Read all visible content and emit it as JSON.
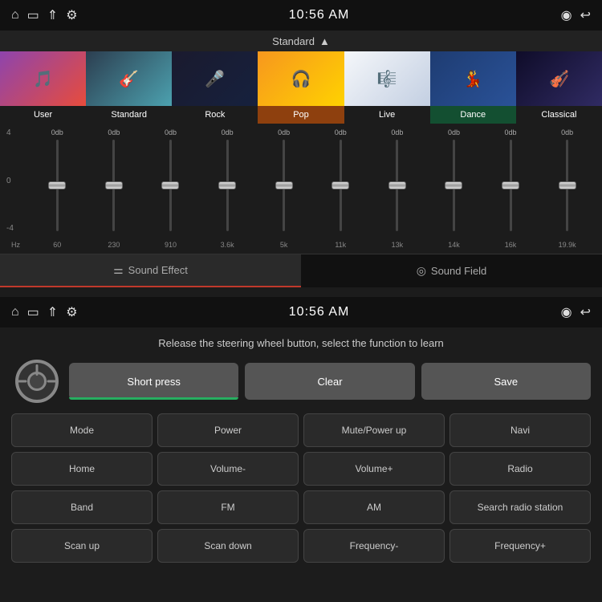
{
  "top": {
    "status_bar": {
      "time": "10:56 AM",
      "icons_left": [
        "home",
        "screen",
        "up-arrow",
        "usb"
      ],
      "icons_right": [
        "location",
        "back"
      ]
    },
    "genre_selector": {
      "label": "Standard",
      "arrow": "▲"
    },
    "genres": [
      {
        "name": "User",
        "active": false
      },
      {
        "name": "Standard",
        "active": false
      },
      {
        "name": "Rock",
        "active": false
      },
      {
        "name": "Pop",
        "active": true
      },
      {
        "name": "Live",
        "active": false
      },
      {
        "name": "Dance",
        "active": false
      },
      {
        "name": "Classical",
        "active": false
      }
    ],
    "eq": {
      "db_labels": [
        "0db",
        "0db",
        "0db",
        "0db",
        "0db",
        "0db",
        "0db",
        "0db",
        "0db",
        "0db"
      ],
      "freq_labels": [
        "60",
        "230",
        "910",
        "3.6k",
        "5k",
        "11k",
        "13k",
        "14k",
        "16k",
        "19.9k"
      ],
      "y_labels": [
        "4",
        "0",
        "-4"
      ],
      "hz_label": "Hz"
    },
    "tabs": [
      {
        "label": "Sound Effect",
        "icon": "sliders",
        "active": true
      },
      {
        "label": "Sound Field",
        "icon": "circle-dot",
        "active": false
      }
    ]
  },
  "bottom": {
    "status_bar": {
      "time": "10:56 AM"
    },
    "instruction": "Release the steering wheel button, select the function to learn",
    "controls": {
      "short_press_label": "Short press",
      "clear_label": "Clear",
      "save_label": "Save"
    },
    "functions": [
      "Mode",
      "Power",
      "Mute/Power up",
      "Navi",
      "Home",
      "Volume-",
      "Volume+",
      "Radio",
      "Band",
      "FM",
      "AM",
      "Search radio station",
      "Scan up",
      "Scan down",
      "Frequency-",
      "Frequency+"
    ]
  }
}
